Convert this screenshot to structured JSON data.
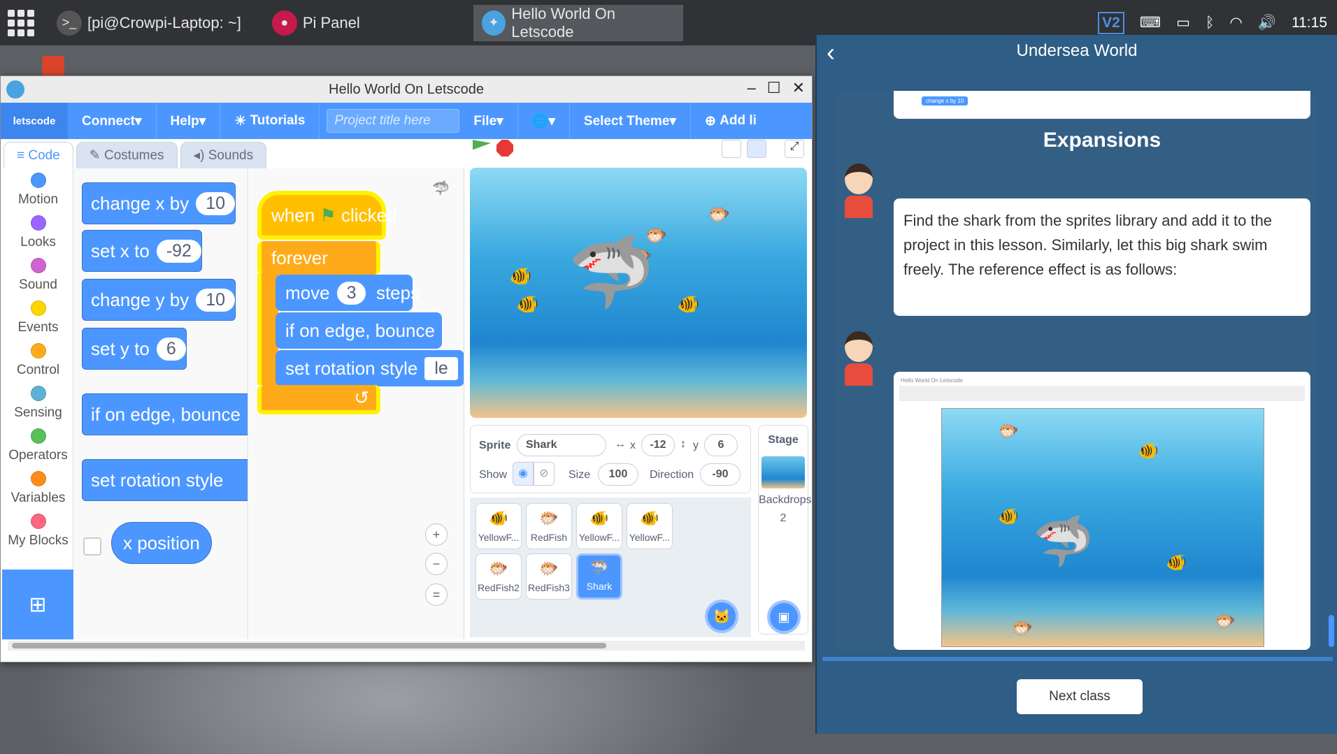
{
  "taskbar": {
    "terminal": "[pi@Crowpi-Laptop: ~]",
    "pipanel": "Pi Panel",
    "active": "Hello World On Letscode",
    "time": "11:15"
  },
  "window": {
    "title": "Hello World On Letscode"
  },
  "menu": {
    "logo": "letscode",
    "connect": "Connect▾",
    "help": "Help▾",
    "tutorials": "Tutorials",
    "project_placeholder": "Project title here",
    "file": "File▾",
    "globe": "🌐▾",
    "theme": "Select Theme▾",
    "add": "Add li"
  },
  "tabs": {
    "code": "Code",
    "costumes": "Costumes",
    "sounds": "Sounds"
  },
  "categories": [
    {
      "name": "Motion",
      "color": "#4c97ff"
    },
    {
      "name": "Looks",
      "color": "#9966ff"
    },
    {
      "name": "Sound",
      "color": "#cf63cf"
    },
    {
      "name": "Events",
      "color": "#ffd500"
    },
    {
      "name": "Control",
      "color": "#ffab19"
    },
    {
      "name": "Sensing",
      "color": "#5cb1d6"
    },
    {
      "name": "Operators",
      "color": "#59c059"
    },
    {
      "name": "Variables",
      "color": "#ff8c1a"
    },
    {
      "name": "My Blocks",
      "color": "#ff6680"
    }
  ],
  "palette": {
    "b1": "change x by",
    "b1v": "10",
    "b2": "set x to",
    "b2v": "-92",
    "b3": "change y by",
    "b3v": "10",
    "b4": "set y to",
    "b4v": "6",
    "b5": "if on edge, bounce",
    "b6": "set rotation style",
    "b7": "x position"
  },
  "script": {
    "when": "when",
    "clicked": "clicked",
    "forever": "forever",
    "move": "move",
    "move_v": "3",
    "steps": "steps",
    "bounce": "if on edge, bounce",
    "rotation": "set rotation style",
    "rotation_v": "le"
  },
  "sprite_info": {
    "sprite_label": "Sprite",
    "sprite_name": "Shark",
    "x_label": "x",
    "x": "-12",
    "y_label": "y",
    "y": "6",
    "show_label": "Show",
    "size_label": "Size",
    "size": "100",
    "direction_label": "Direction",
    "direction": "-90"
  },
  "sprites": [
    "YellowF...",
    "RedFish",
    "YellowF...",
    "YellowF...",
    "RedFish2",
    "RedFish3",
    "Shark"
  ],
  "stage_panel": {
    "title": "Stage",
    "backdrops": "Backdrops",
    "count": "2"
  },
  "lesson": {
    "title": "Undersea World",
    "heading": "Expansions",
    "text": "Find the shark from the sprites library and add it to the project in this lesson. Similarly, let this big shark swim freely. The reference effect is as follows:",
    "next": "Next class",
    "thumb_block": "change x by",
    "thumb_val": "10",
    "ref_title": "Hello World On Letscode"
  }
}
